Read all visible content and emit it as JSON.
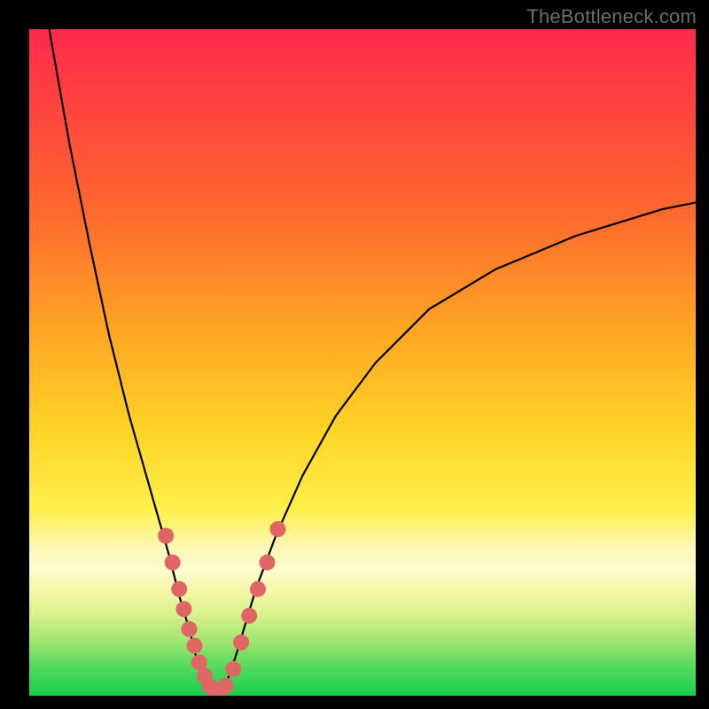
{
  "watermark": "TheBottleneck.com",
  "colors": {
    "frame": "#000000",
    "curve_color": "#000000",
    "marker_fill": "#e06666",
    "marker_stroke": "#d85a5a"
  },
  "chart_data": {
    "type": "line",
    "title": "",
    "xlabel": "",
    "ylabel": "",
    "xlim": [
      0,
      100
    ],
    "ylim": [
      0,
      100
    ],
    "series": [
      {
        "name": "left-branch",
        "x": [
          3,
          6,
          9,
          12,
          15,
          17,
          19,
          21,
          22.5,
          24,
          25,
          26,
          27,
          28
        ],
        "y": [
          100,
          83,
          68,
          54,
          42,
          35,
          28,
          21,
          15,
          10,
          6,
          3,
          1,
          0
        ]
      },
      {
        "name": "right-branch",
        "x": [
          28,
          29,
          30,
          31,
          32.5,
          34,
          37,
          41,
          46,
          52,
          60,
          70,
          82,
          95,
          100
        ],
        "y": [
          0,
          1,
          3,
          6,
          11,
          16,
          24,
          33,
          42,
          50,
          58,
          64,
          69,
          73,
          74
        ]
      }
    ],
    "markers": {
      "name": "data-points",
      "x": [
        20.5,
        21.5,
        22.5,
        23.2,
        24.0,
        24.8,
        25.5,
        26.3,
        27.0,
        27.8,
        28.6,
        29.5,
        30.6,
        31.8,
        33.0,
        34.3,
        35.7,
        37.3
      ],
      "y": [
        24,
        20,
        16,
        13,
        10,
        7.5,
        5,
        3,
        1.5,
        0.8,
        0.8,
        1.5,
        4,
        8,
        12,
        16,
        20,
        25
      ]
    }
  }
}
